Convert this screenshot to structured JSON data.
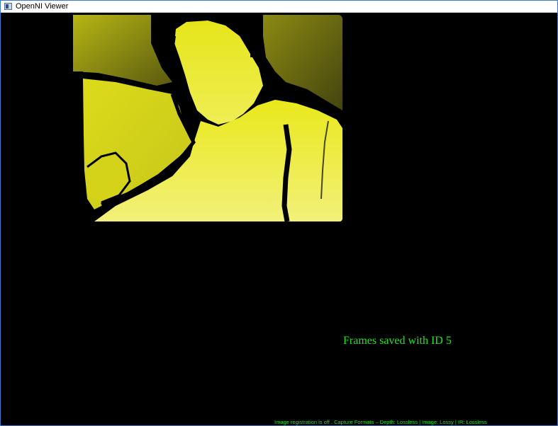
{
  "window": {
    "title": "OpenNI Viewer",
    "icon": "app-window-icon"
  },
  "viewer": {
    "depth_view": {
      "description_colors": {
        "background": "#000000",
        "depth_near": "#f0ef1e",
        "depth_mid": "#c8c816",
        "depth_far": "#4a4a10"
      }
    },
    "message": "Frames saved with ID 5",
    "status_line": "Image registration is off . Capture Formats – Depth: Lossless | Image: Lossy | IR: Lossless",
    "text_color": "#1ee61e"
  }
}
